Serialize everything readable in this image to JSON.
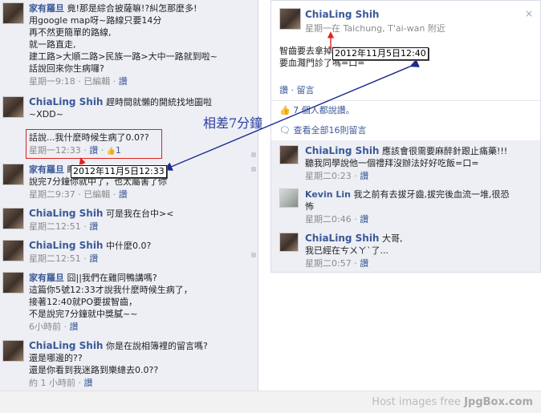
{
  "left_comments": [
    {
      "author": "家有羅旦",
      "text": " 竟!那是綜合披薩嘛!?糾怎那麼多!",
      "lines": [
        "用google map呀~路線只要14分",
        "再不然更簡單的路線,",
        "就一路直走,",
        "建工路>大順二路>民族一路>大中一路就到啦~",
        "話說回來你生病囉?"
      ],
      "time": "星期一9:18",
      "action": "已編輯",
      "link": "讚"
    },
    {
      "author": "ChiaLing Shih",
      "text": " 趕時間就懶的開統找地圖啦",
      "lines": [
        "~XDD~"
      ],
      "time": "",
      "action": "",
      "link": ""
    },
    {
      "author": "家有羅旦",
      "text": " 瞎了",
      "lines": [
        "說完7分鐘你就中了，也太屬害了你"
      ],
      "time": "星期二9:37",
      "action": "已編輯",
      "link": "讚"
    },
    {
      "author": "ChiaLing Shih",
      "text": " 可是我在台中><",
      "lines": [],
      "time": "星期二12:51",
      "action": "",
      "link": "讚"
    },
    {
      "author": "ChiaLing Shih",
      "text": " 中什麼0.0?",
      "lines": [],
      "time": "星期二12:51",
      "action": "",
      "link": "讚"
    },
    {
      "author": "家有羅旦",
      "text": " 囧||我們在雞同鴨講嗎?",
      "lines": [
        "這篇你5號12:33才說我什麼時候生病了，",
        "接著12:40就PO要拔智齒，",
        "不是說完7分鐘就中獎膩~~"
      ],
      "time": "6小時前",
      "action": "",
      "link": "讚"
    },
    {
      "author": "ChiaLing Shih",
      "text": " 你是在說相簿裡的留言嗎?",
      "lines": [
        "還是哪邊的??",
        "還是你看到我迷路到樂總去0.0??"
      ],
      "time": "約 1 小時前",
      "action": "",
      "link": "讚"
    }
  ],
  "highlight": {
    "text": "話說...我什麼時候生病了0.0??",
    "time": "星期一12:33",
    "link": "讚",
    "likes": "1"
  },
  "annotation": {
    "label": "相差7分鐘",
    "tooltip_left": "2012年11月5日12:33",
    "tooltip_right": "2012年11月5日12:40"
  },
  "post": {
    "author": "ChiaLing Shih",
    "time": "星期一在 Taichung, T'ai-wan 附近",
    "lines": [
      "智齒要去拿掉了~",
      "要血濺門診了嗎=口="
    ],
    "actions": "讚 · 留言",
    "likes": "7 個人都說讚。",
    "view_all": "查看全部16則留言",
    "close": "×"
  },
  "post_comments": [
    {
      "author": "ChiaLing Shih",
      "text": " 應該會很需要麻醉針跟止痛藥!!!",
      "lines": [
        "聽我同學說他一個禮拜沒辦法好好吃飯=口="
      ],
      "time": "星期二0:23",
      "link": "讚"
    },
    {
      "author": "Kevin Lin",
      "text": " 我之前有去拔牙齒,拔完後血流一堆,很恐",
      "lines": [
        "怖"
      ],
      "time": "星期二0:46",
      "link": "讚"
    },
    {
      "author": "ChiaLing Shih",
      "text": " 大哥,",
      "lines": [
        "我已經在ㄘㄨㄚˋ了..."
      ],
      "time": "星期二0:57",
      "link": "讚"
    }
  ],
  "footer": {
    "prefix": "Host images free ",
    "brand": "JpgBox.com"
  },
  "colors": {
    "link": "#3b5998",
    "panel_bg": "#edeff4",
    "annotation": "#2b3ea0",
    "highlight": "#e02020"
  }
}
